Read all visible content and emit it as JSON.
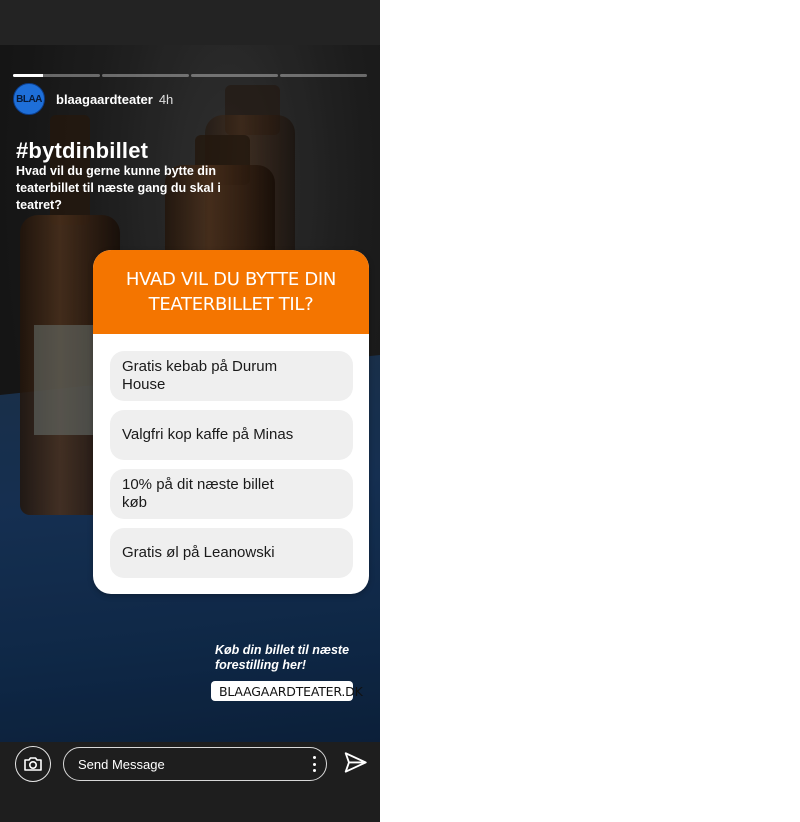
{
  "story": {
    "progress_segments": [
      0.35,
      0,
      0,
      0
    ],
    "username": "blaagaardteater",
    "time": "4h",
    "avatar_text": "BLAA",
    "hashtag": "#bytdinbillet",
    "caption": "Hvad vil du gerne kunne bytte din teaterbillet til næste gang du skal i teatret?"
  },
  "quiz": {
    "title": "HVAD VIL DU BYTTE DIN TEATERBILLET TIL?",
    "options": [
      "Gratis kebab på Durum House",
      "Valgfri kop kaffe på Minas",
      "10% på dit næste billet køb",
      "Gratis øl på Leanowski"
    ],
    "accent_color": "#f47500"
  },
  "cta": {
    "text": "Køb din billet til næste forestilling her!",
    "link_label": "BLAAGAARDTEATER.DK"
  },
  "composer": {
    "placeholder": "Send Message"
  }
}
